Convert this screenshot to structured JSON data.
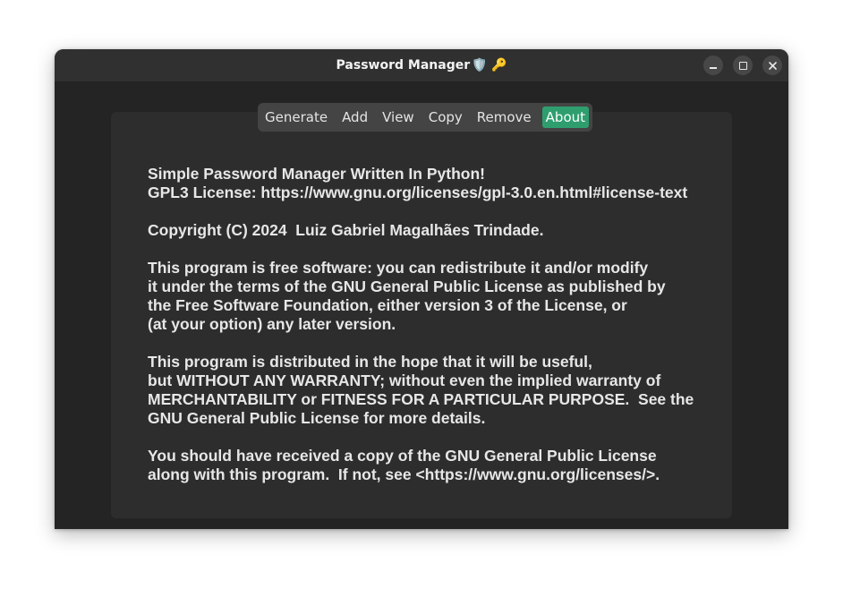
{
  "window": {
    "title": "Password Manager",
    "title_icons": "🛡️ 🔑",
    "controls": {
      "minimize": "minimize-icon",
      "maximize": "maximize-icon",
      "close": "close-icon"
    }
  },
  "tabs": [
    {
      "label": "Generate",
      "active": false
    },
    {
      "label": "Add",
      "active": false
    },
    {
      "label": "View",
      "active": false
    },
    {
      "label": "Copy",
      "active": false
    },
    {
      "label": "Remove",
      "active": false
    },
    {
      "label": "About",
      "active": true
    }
  ],
  "colors": {
    "active_tab": "#2e9e6e",
    "window_bg": "#242424",
    "panel_bg": "#2d2d2d"
  },
  "about": {
    "text": "Simple Password Manager Written In Python!\nGPL3 License: https://www.gnu.org/licenses/gpl-3.0.en.html#license-text\n\nCopyright (C) 2024  Luiz Gabriel Magalhães Trindade.\n\nThis program is free software: you can redistribute it and/or modify\nit under the terms of the GNU General Public License as published by\nthe Free Software Foundation, either version 3 of the License, or\n(at your option) any later version.\n\nThis program is distributed in the hope that it will be useful,\nbut WITHOUT ANY WARRANTY; without even the implied warranty of\nMERCHANTABILITY or FITNESS FOR A PARTICULAR PURPOSE.  See the\nGNU General Public License for more details.\n\nYou should have received a copy of the GNU General Public License\nalong with this program.  If not, see <https://www.gnu.org/licenses/>."
  }
}
